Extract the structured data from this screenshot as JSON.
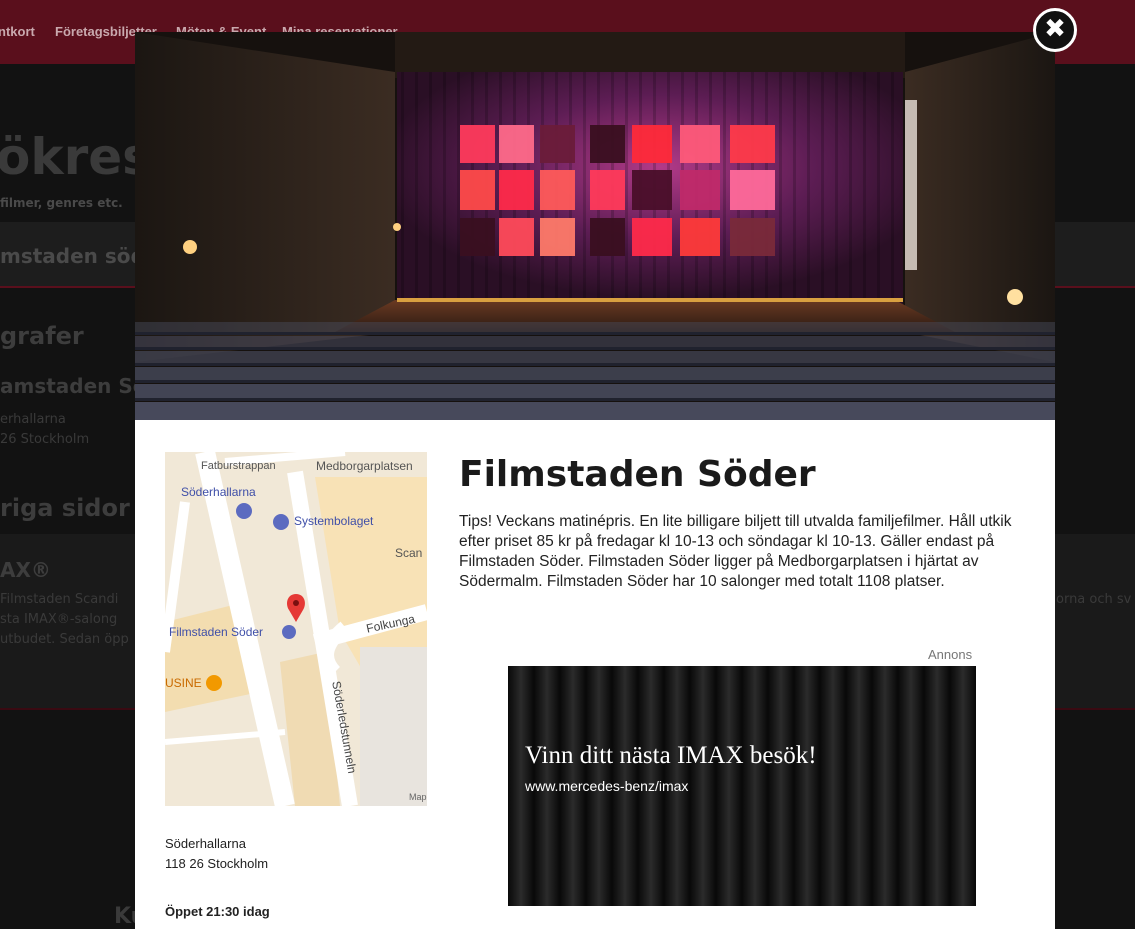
{
  "background": {
    "nav": [
      "ntkort",
      "Företagsbiljetter",
      "Möten & Event",
      "Mina reservationer"
    ],
    "title": "ökresu",
    "subtitle": "filmer, genres etc.",
    "search_value": "mstaden söde",
    "section_grafer": "grafer",
    "result_name": "amstaden Söd",
    "result_line1": "erhallarna",
    "result_line2": "26 Stockholm",
    "section_sidor": "riga sidor",
    "imax_title": "AX®",
    "imax_line1": "Filmstaden Scandi",
    "imax_line2": "sta IMAX®-salong",
    "imax_line3": "utbudet. Sedan öpp",
    "imax_right": "orna och sv",
    "footer": "Ku"
  },
  "modal": {
    "close_label": "✖",
    "cinema_title": "Filmstaden Söder",
    "description": "Tips! Veckans matinépris. En lite billigare biljett till utvalda familjefilmer. Håll utkik efter priset 85 kr på fredagar kl 10-13 och söndagar kl 10-13. Gäller endast på Filmstaden Söder. Filmstaden Söder ligger på Medborgarplatsen i hjärtat av Södermalm. Filmstaden Söder har 10 salonger med totalt 1108 platser.",
    "address_line1": "Söderhallarna",
    "address_line2": "118 26 Stockholm",
    "opening": "Öppet 21:30 idag",
    "ad_label": "Annons",
    "ad_headline": "Vinn ditt nästa IMAX besök!",
    "ad_url": "www.mercedes-benz/imax"
  },
  "map": {
    "labels": {
      "fatbur": "Fatburstrappan",
      "medborgar": "Medborgarplatsen",
      "soderhallarna": "Söderhallarna",
      "systembolaget": "Systembolaget",
      "scan": "Scan",
      "filmstaden": "Filmstaden Söder",
      "folkunga": "Folkunga",
      "usine": "USINE",
      "soderleds": "Söderledstunneln",
      "map_credit": "Map"
    },
    "icons": [
      "shopping-bag-icon",
      "shopping-bag-icon",
      "map-pin-icon",
      "film-icon",
      "restaurant-icon"
    ]
  },
  "colors": {
    "nav_bg": "#5a0f1c",
    "close_bg": "#111111",
    "pin": "#e53935",
    "poi_blue": "#5c6bc0",
    "poi_orange": "#f29900"
  }
}
